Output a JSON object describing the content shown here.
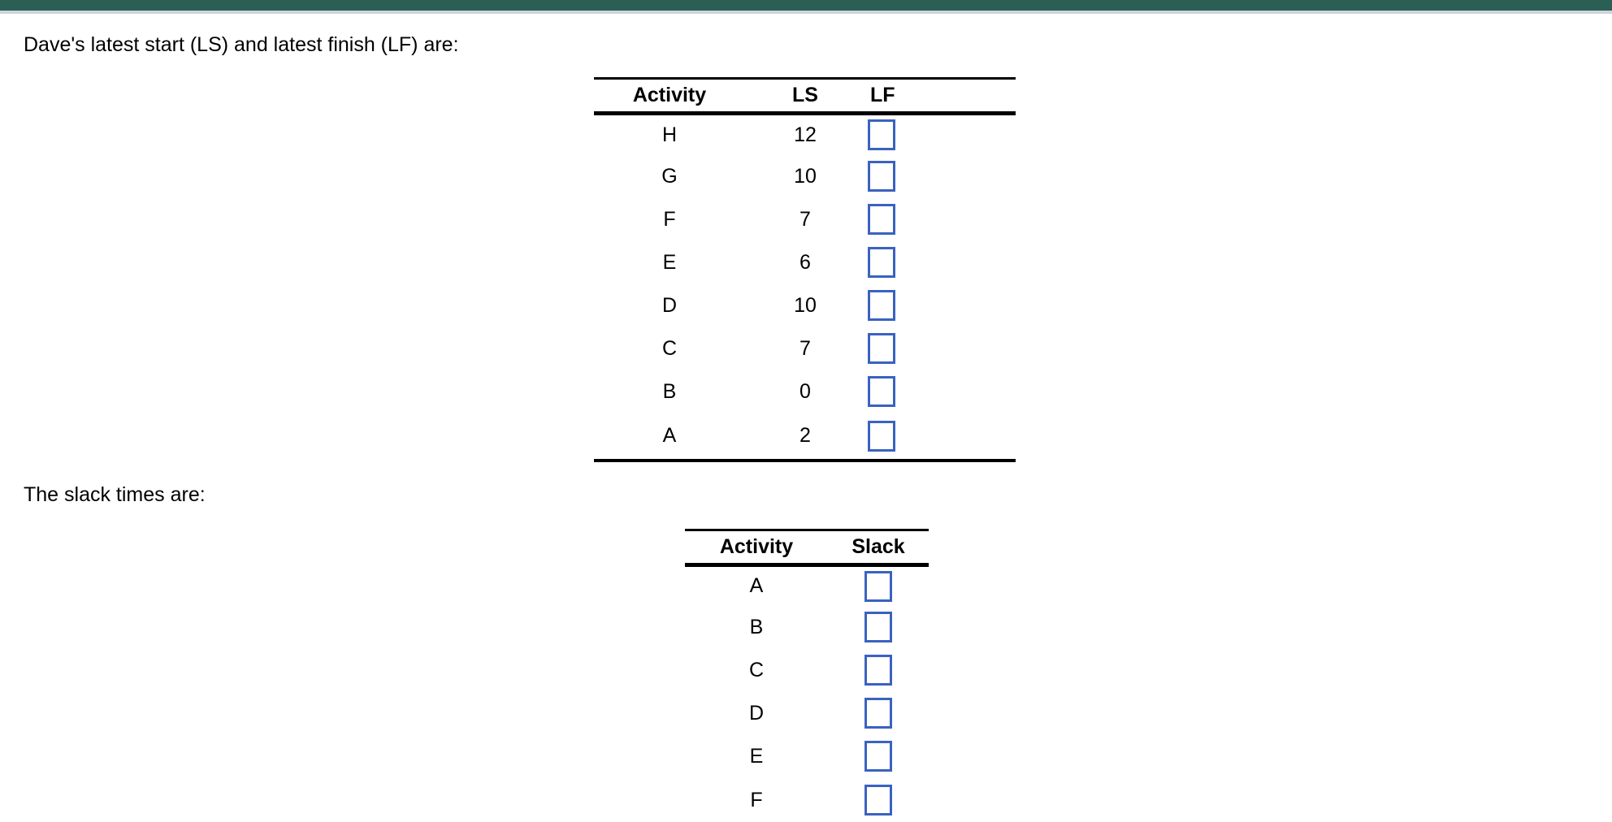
{
  "window": {
    "top_bar_color": "#2b5f55",
    "sub_bar_color": "#ced4de",
    "page_background": "#ffffff"
  },
  "accent": {
    "input_border_color": "#3a62c0",
    "rule_color": "#000000"
  },
  "prompts": {
    "ls_lf": "Dave's latest start (LS) and latest finish (LF) are:",
    "slack": "The slack times are:"
  },
  "ls_lf_table": {
    "name": "latest-start-latest-finish-table",
    "columns": [
      "Activity",
      "LS",
      "LF"
    ],
    "rows": [
      {
        "activity": "H",
        "ls": "12",
        "lf": ""
      },
      {
        "activity": "G",
        "ls": "10",
        "lf": ""
      },
      {
        "activity": "F",
        "ls": "7",
        "lf": ""
      },
      {
        "activity": "E",
        "ls": "6",
        "lf": ""
      },
      {
        "activity": "D",
        "ls": "10",
        "lf": ""
      },
      {
        "activity": "C",
        "ls": "7",
        "lf": ""
      },
      {
        "activity": "B",
        "ls": "0",
        "lf": ""
      },
      {
        "activity": "A",
        "ls": "2",
        "lf": ""
      }
    ]
  },
  "slack_table": {
    "name": "slack-times-table",
    "columns": [
      "Activity",
      "Slack"
    ],
    "rows": [
      {
        "activity": "A",
        "slack": ""
      },
      {
        "activity": "B",
        "slack": ""
      },
      {
        "activity": "C",
        "slack": ""
      },
      {
        "activity": "D",
        "slack": ""
      },
      {
        "activity": "E",
        "slack": ""
      },
      {
        "activity": "F",
        "slack": ""
      }
    ]
  }
}
